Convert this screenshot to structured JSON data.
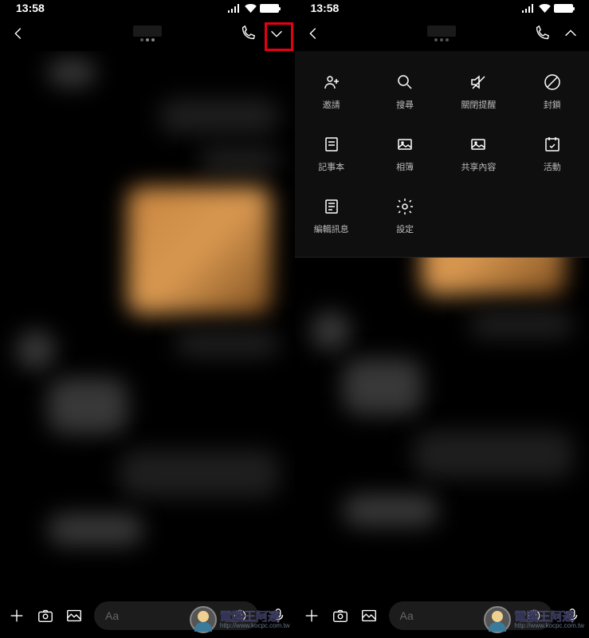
{
  "status": {
    "time": "13:58"
  },
  "inputbar": {
    "placeholder": "Aa"
  },
  "menu": {
    "items": [
      {
        "label": "邀請",
        "icon": "invite-icon"
      },
      {
        "label": "搜尋",
        "icon": "search-icon"
      },
      {
        "label": "關閉提醒",
        "icon": "mute-icon"
      },
      {
        "label": "封鎖",
        "icon": "block-icon"
      },
      {
        "label": "記事本",
        "icon": "note-icon"
      },
      {
        "label": "相簿",
        "icon": "album-icon"
      },
      {
        "label": "共享內容",
        "icon": "shared-content-icon"
      },
      {
        "label": "活動",
        "icon": "event-icon"
      },
      {
        "label": "編輯訊息",
        "icon": "edit-icon"
      },
      {
        "label": "設定",
        "icon": "settings-icon"
      }
    ]
  },
  "watermark": {
    "title": "電腦王阿達",
    "url": "http://www.kocpc.com.tw"
  }
}
